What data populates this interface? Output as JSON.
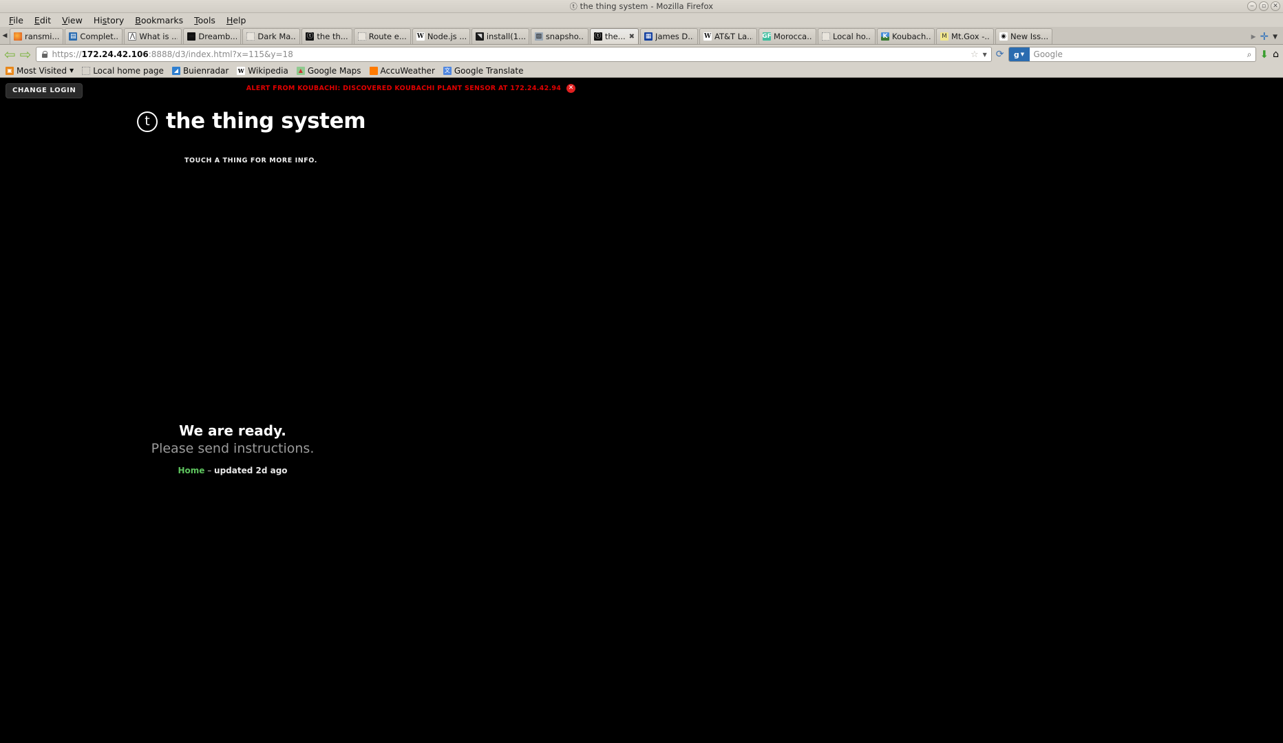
{
  "window": {
    "title": "the thing system - Mozilla Firefox",
    "title_glyph": "ⓣ",
    "buttons": [
      {
        "name": "minimize",
        "glyph": "‒"
      },
      {
        "name": "maximize",
        "glyph": "▫"
      },
      {
        "name": "close",
        "glyph": "✕"
      }
    ]
  },
  "menubar": {
    "items": [
      {
        "label": "File",
        "accel": "F"
      },
      {
        "label": "Edit",
        "accel": "E"
      },
      {
        "label": "View",
        "accel": "V"
      },
      {
        "label": "History",
        "accel": "s"
      },
      {
        "label": "Bookmarks",
        "accel": "B"
      },
      {
        "label": "Tools",
        "accel": "T"
      },
      {
        "label": "Help",
        "accel": "H"
      }
    ]
  },
  "tabbar": {
    "scroll_left_glyph": "◀",
    "scroll_right_glyph": "▶",
    "new_tab_glyph": "✛",
    "tab_list_glyph": "▼",
    "tabs": [
      {
        "label": "ransmi...",
        "icon": "ff-icon",
        "glyph": "",
        "icon_class": "fv-ff",
        "active": false,
        "close": false
      },
      {
        "label": "Complet...",
        "icon": "document-icon",
        "glyph": "▤",
        "icon_class": "fv-blue",
        "active": false,
        "close": false
      },
      {
        "label": "What is ...",
        "icon": "compass-icon",
        "glyph": "⋀",
        "icon_class": "fv-blueline",
        "active": false,
        "close": false
      },
      {
        "label": "Dreamb...",
        "icon": "monitor-icon",
        "glyph": "▬",
        "icon_class": "fv-dark",
        "active": false,
        "close": false
      },
      {
        "label": "Dark Ma...",
        "icon": "blank-page-icon",
        "glyph": "",
        "icon_class": "fv-dotted",
        "active": false,
        "close": false
      },
      {
        "label": "the th...",
        "icon": "thing-system-icon",
        "glyph": "ⓣ",
        "icon_class": "fv-circle",
        "active": false,
        "close": false
      },
      {
        "label": "Route e...",
        "icon": "blank-page-icon",
        "glyph": "",
        "icon_class": "fv-dotted",
        "active": false,
        "close": false
      },
      {
        "label": "Node.js ...",
        "icon": "wikipedia-icon",
        "glyph": "W",
        "icon_class": "fv-w",
        "active": false,
        "close": false
      },
      {
        "label": "install(1...",
        "icon": "terminal-icon",
        "glyph": "◥",
        "icon_class": "fv-install",
        "active": false,
        "close": false
      },
      {
        "label": "snapsho...",
        "icon": "image-icon",
        "glyph": "▨",
        "icon_class": "fv-snap",
        "active": false,
        "close": false
      },
      {
        "label": "the...",
        "icon": "thing-system-icon",
        "glyph": "ⓣ",
        "icon_class": "fv-circle",
        "active": true,
        "close": true
      },
      {
        "label": "James D...",
        "icon": "calendar-icon",
        "glyph": "▦",
        "icon_class": "fv-james",
        "active": false,
        "close": false
      },
      {
        "label": "AT&T La...",
        "icon": "wikipedia-icon",
        "glyph": "W",
        "icon_class": "fv-w",
        "active": false,
        "close": false
      },
      {
        "label": "Morocca...",
        "icon": "greenfield-icon",
        "glyph": "GF",
        "icon_class": "fv-gf",
        "active": false,
        "close": false
      },
      {
        "label": "Local ho...",
        "icon": "blank-page-icon",
        "glyph": "",
        "icon_class": "fv-dotted",
        "active": false,
        "close": false
      },
      {
        "label": "Koubach...",
        "icon": "koubachi-icon",
        "glyph": "K",
        "icon_class": "fv-k",
        "active": false,
        "close": false
      },
      {
        "label": "Mt.Gox -...",
        "icon": "mtgox-icon",
        "glyph": "M",
        "icon_class": "fv-mtgox",
        "active": false,
        "close": false
      },
      {
        "label": "New Iss...",
        "icon": "github-icon",
        "glyph": "◉",
        "icon_class": "fv-gh",
        "active": false,
        "close": false
      }
    ],
    "close_glyph": "✖"
  },
  "navbar": {
    "back_glyph": "⇦",
    "forward_glyph": "⇨",
    "url_scheme": "https://",
    "url_host": "172.24.42.106",
    "url_rest": ":8888/d3/index.html?x=115&y=18",
    "url_full": "https://172.24.42.106:8888/d3/index.html?x=115&y=18",
    "star_glyph": "☆",
    "dropdown_glyph": "▼",
    "reload_glyph": "⟳",
    "search_engine": "g",
    "search_engine_caret": "▼",
    "search_placeholder": "Google",
    "search_mag_glyph": "🔍",
    "download_glyph": "⬇",
    "home_glyph": "🏠"
  },
  "bookmarks": {
    "items": [
      {
        "label": "Most Visited",
        "icon": "folder-star-icon",
        "glyph": "▣",
        "icon_class": "bmi-most",
        "caret": "▼"
      },
      {
        "label": "Local home page",
        "icon": "blank-page-icon",
        "glyph": "",
        "icon_class": "bmi-dotted",
        "caret": ""
      },
      {
        "label": "Buienradar",
        "icon": "buienradar-icon",
        "glyph": "◢",
        "icon_class": "bmi-buien",
        "caret": ""
      },
      {
        "label": "Wikipedia",
        "icon": "wikipedia-icon",
        "glyph": "W",
        "icon_class": "bmi-wiki",
        "caret": ""
      },
      {
        "label": "Google Maps",
        "icon": "google-maps-icon",
        "glyph": "▲",
        "icon_class": "bmi-gmaps",
        "caret": ""
      },
      {
        "label": "AccuWeather",
        "icon": "accuweather-icon",
        "glyph": "",
        "icon_class": "bmi-accu",
        "caret": ""
      },
      {
        "label": "Google Translate",
        "icon": "google-translate-icon",
        "glyph": "文",
        "icon_class": "bmi-gtrans",
        "caret": ""
      }
    ]
  },
  "page": {
    "change_login_label": "CHANGE LOGIN",
    "alert": {
      "text": "ALERT FROM KOUBACHI: DISCOVERED KOUBACHI PLANT SENSOR AT 172.24.42.94",
      "dismiss_glyph": "✕",
      "color": "#e00000"
    },
    "brand": {
      "mark_letter": "t",
      "title": "the thing system"
    },
    "touch_hint": "TOUCH A THING FOR MORE INFO.",
    "status": {
      "headline": "We are ready.",
      "subline": "Please send instructions.",
      "place": "Home",
      "separator": " – ",
      "updated": "updated 2d ago",
      "place_color": "#5ec45e"
    }
  }
}
